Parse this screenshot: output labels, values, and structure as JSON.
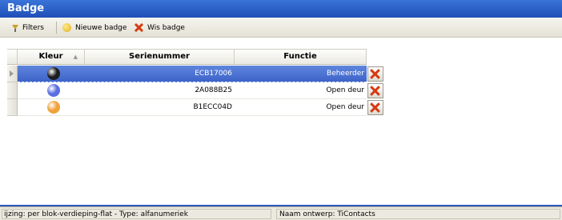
{
  "window": {
    "title": "Badge"
  },
  "toolbar": {
    "filters_label": "Filters",
    "new_badge_label": "Nieuwe badge",
    "delete_badge_label": "Wis badge"
  },
  "table": {
    "columns": [
      "Kleur",
      "Serienummer",
      "Functie"
    ],
    "rows": [
      {
        "color": "#1c1c1c",
        "serial": "ECB17006",
        "function": "Beheerder",
        "selected": true
      },
      {
        "color": "#5a6fe0",
        "serial": "2A088B25",
        "function": "Open deur",
        "selected": false
      },
      {
        "color": "#f0a23a",
        "serial": "B1ECC04D",
        "function": "Open deur",
        "selected": false
      }
    ]
  },
  "icons": {
    "filter": "funnel-icon",
    "new": "yellow-circle-icon",
    "delete": "red-x-icon",
    "row_delete": "red-x-icon"
  },
  "statusbar": {
    "left_text": "ijzing: per blok-verdieping-flat - Type: alfanumeriek",
    "right_text": "Naam ontwerp: TiContacts"
  }
}
